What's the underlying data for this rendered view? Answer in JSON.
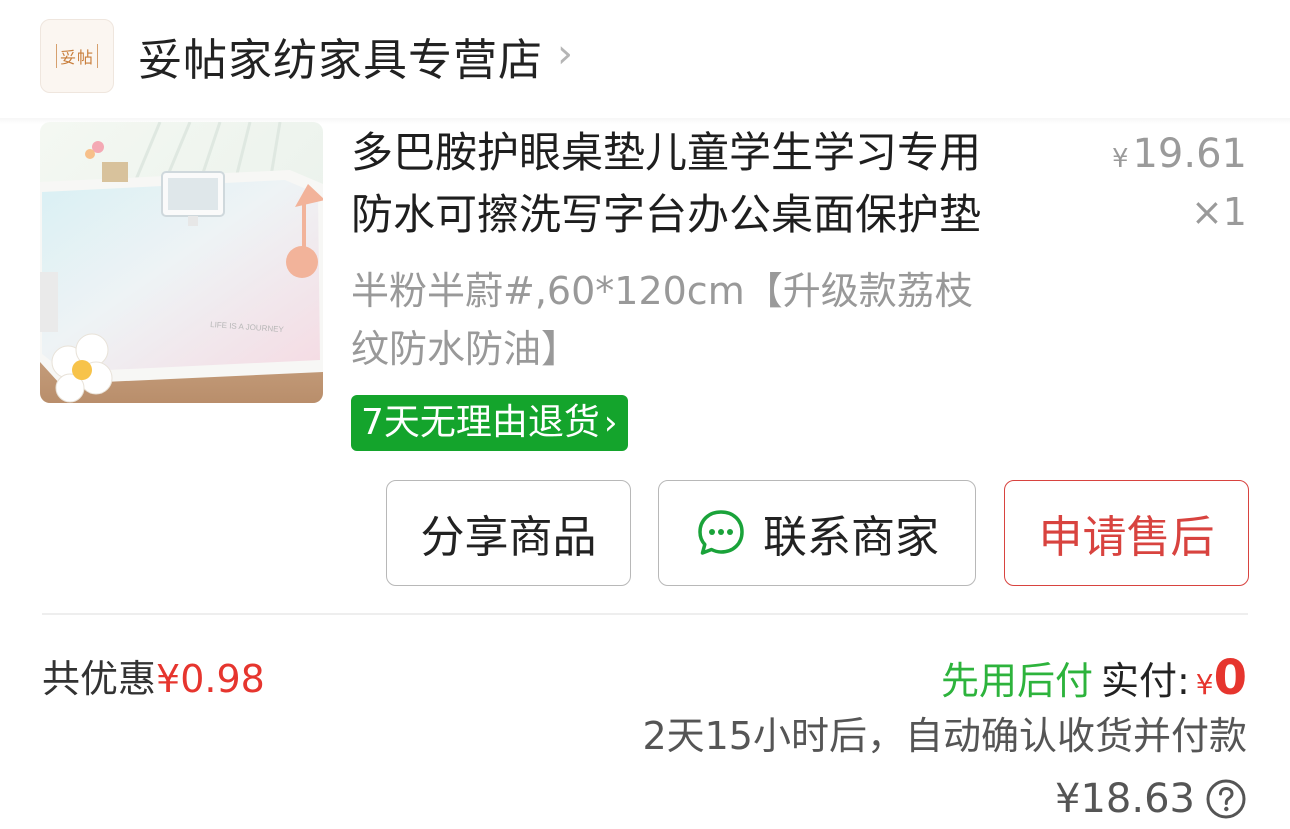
{
  "store": {
    "logo_text": "妥帖",
    "name": "妥帖家纺家具专营店"
  },
  "product": {
    "title_line1": "多巴胺护眼桌垫儿童学生学习专用",
    "title_line2": "防水可擦洗写字台办公桌面保护垫",
    "price_symbol": "¥",
    "price": "19.61",
    "quantity": "×1",
    "spec_line1": "半粉半蔚#,60*120cm【升级款荔枝",
    "spec_line2": "纹防水防油】",
    "return_badge": "7天无理由退货",
    "image_caption": "LIFE IS A JOURNEY"
  },
  "actions": {
    "share": "分享商品",
    "contact": "联系商家",
    "after_sale": "申请售后"
  },
  "summary": {
    "discount_label": "共优惠",
    "discount_amount": "¥0.98",
    "pay_later": "先用后付",
    "paid_label": "实付:",
    "paid_symbol": "¥",
    "paid_amount": "0",
    "auto_confirm": "2天15小时后，自动确认收货并付款",
    "total": "¥18.63"
  },
  "colors": {
    "return_badge_bg": "#14a42c",
    "accent_red": "#e6352e",
    "pay_later_green": "#2db33c",
    "after_sale_red": "#d8433f"
  }
}
